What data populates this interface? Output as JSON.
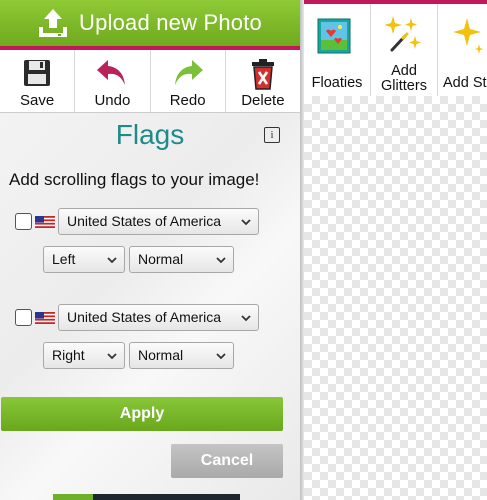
{
  "upload": {
    "label": "Upload new Photo",
    "icon": "upload-icon"
  },
  "toolbar": {
    "items": [
      {
        "label": "Save",
        "icon": "floppy-disk-icon"
      },
      {
        "label": "Undo",
        "icon": "undo-arrow-icon"
      },
      {
        "label": "Redo",
        "icon": "redo-arrow-icon"
      },
      {
        "label": "Delete",
        "icon": "trash-icon"
      }
    ]
  },
  "panel": {
    "title": "Flags",
    "info_label": "i",
    "description": "Add scrolling flags to your image!",
    "flag_rows": [
      {
        "checked": false,
        "country": "United States of America",
        "position": "Left",
        "speed": "Normal"
      },
      {
        "checked": false,
        "country": "United States of America",
        "position": "Right",
        "speed": "Normal"
      }
    ],
    "apply_label": "Apply",
    "cancel_label": "Cancel"
  },
  "effects": {
    "items": [
      {
        "label": "Floaties",
        "icon": "floaties-icon"
      },
      {
        "label": "Add Glitters",
        "icon": "sparkles-icon"
      },
      {
        "label": "Add St",
        "icon": "sparkles-icon"
      }
    ]
  },
  "colors": {
    "accent_green": "#76b82a",
    "accent_pink": "#c2185b",
    "title_teal": "#1f8a8a",
    "cancel_gray": "#b5b5b5"
  }
}
